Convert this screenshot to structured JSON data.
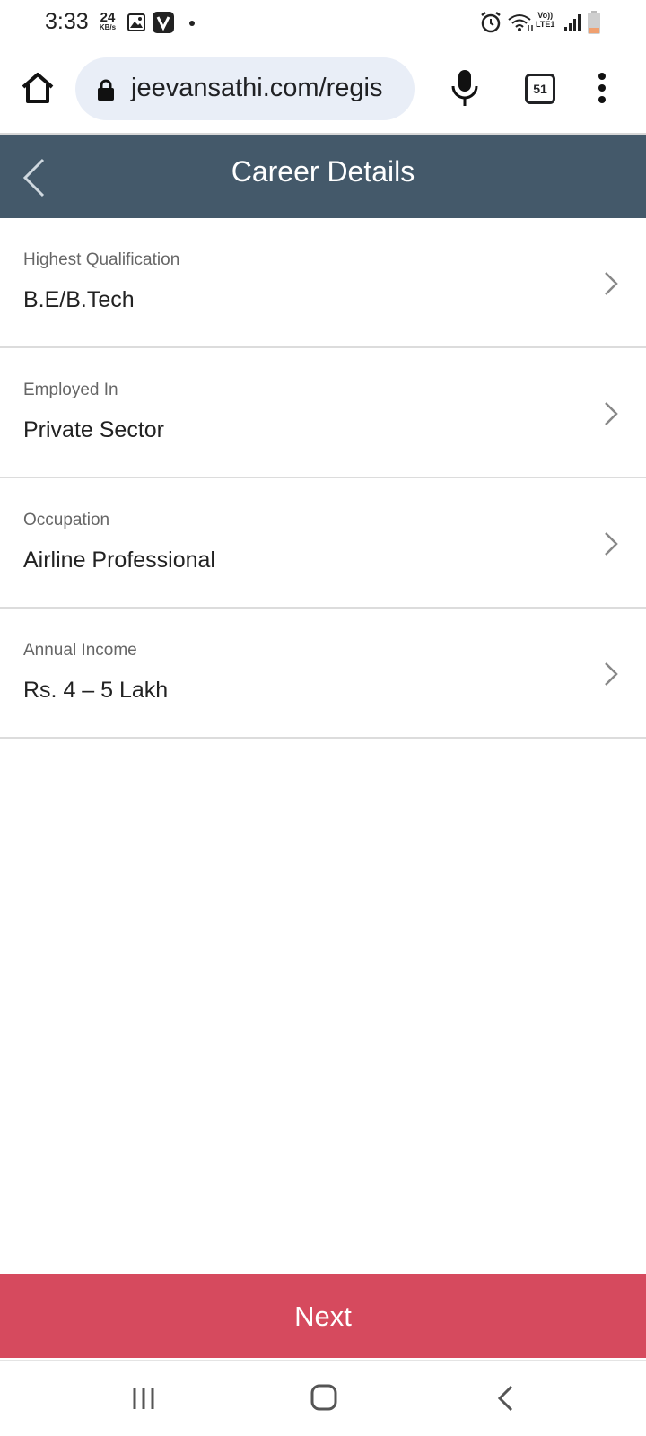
{
  "status_bar": {
    "time": "3:33",
    "speed_value": "24",
    "speed_unit": "KB/s",
    "network_label_top": "Vo))",
    "network_label_bottom": "LTE1"
  },
  "browser": {
    "url": "jeevansathi.com/regis",
    "tab_count": "51"
  },
  "header": {
    "title": "Career Details"
  },
  "form": {
    "rows": [
      {
        "label": "Highest Qualification",
        "value": "B.E/B.Tech"
      },
      {
        "label": "Employed In",
        "value": "Private Sector"
      },
      {
        "label": "Occupation",
        "value": "Airline Professional"
      },
      {
        "label": "Annual Income",
        "value": "Rs. 4 – 5 Lakh"
      }
    ]
  },
  "footer": {
    "next_label": "Next"
  },
  "colors": {
    "header_bg": "#44596a",
    "next_button_bg": "#d64a5e",
    "url_pill_bg": "#e9eef7"
  }
}
